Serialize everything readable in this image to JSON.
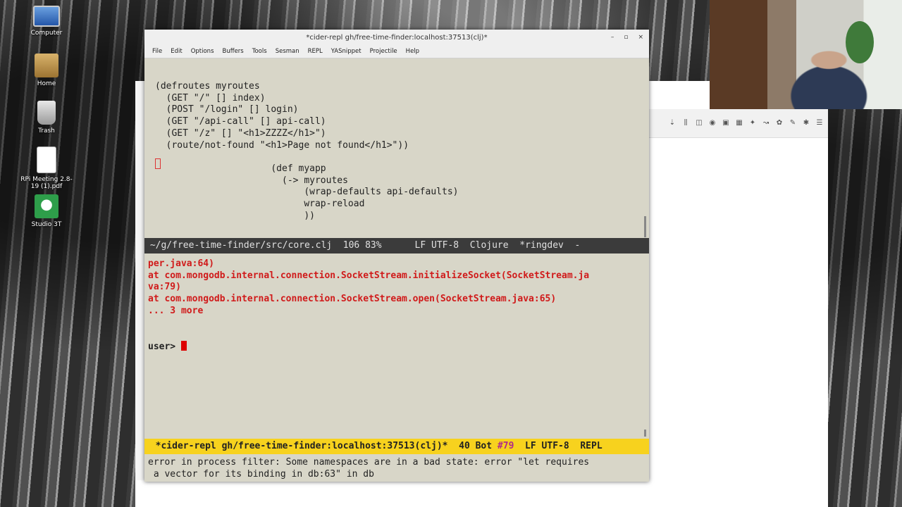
{
  "desktop": {
    "icons": [
      {
        "label": "Computer"
      },
      {
        "label": "Home"
      },
      {
        "label": "Trash"
      },
      {
        "label": "RPi Meeting 2.8-19 (1).pdf"
      },
      {
        "label": "Studio 3T"
      }
    ]
  },
  "window": {
    "title": "*cider-repl gh/free-time-finder:localhost:37513(clj)*",
    "controls": {
      "minimize": "–",
      "maximize": "▫",
      "close": "×"
    }
  },
  "menu": [
    "File",
    "Edit",
    "Options",
    "Buffers",
    "Tools",
    "Sesman",
    "REPL",
    "YASnippet",
    "Projectile",
    "Help"
  ],
  "editor": {
    "line1": "(defroutes myroutes",
    "line2": "  (GET \"/\" [] index)",
    "line3": "  (POST \"/login\" [] login)",
    "line4": "  (GET \"/api-call\" [] api-call)",
    "line5": "  (GET \"/z\" [] \"<h1>ZZZZ</h1>\")",
    "line6": "  (route/not-found \"<h1>Page not found</h1>\"))",
    "line7": "                     (def myapp",
    "line8": "                       (-> myroutes",
    "line9": "                           (wrap-defaults api-defaults)",
    "line10": "                           wrap-reload",
    "line11": "                           ))"
  },
  "modeline_editor": {
    "path": " ~/g/free-time-finder/src/core.clj",
    "position": "  106 83%",
    "encoding": "      LF UTF-8",
    "mode": "  Clojure",
    "extra": "  *ringdev  -"
  },
  "repl": {
    "lines": [
      "per.java:64)",
      "at com.mongodb.internal.connection.SocketStream.initializeSocket(SocketStream.ja",
      "va:79)",
      "at com.mongodb.internal.connection.SocketStream.open(SocketStream.java:65)",
      "... 3 more"
    ],
    "prompt": "user> "
  },
  "modeline_repl": {
    "buffer": "  *cider-repl gh/free-time-finder:localhost:37513(clj)*",
    "position": "  40 Bot ",
    "line_no": "#79",
    "encoding": "  LF UTF-8",
    "mode": "  REPL"
  },
  "echo_area": {
    "line1": "error in process filter: Some namespaces are in a bad state: error \"let requires",
    "line2": " a vector for its binding in db:63\" in db"
  },
  "colors": {
    "emacs_bg": "#d8d6c8",
    "modeline_dark": "#3b3b3b",
    "modeline_repl": "#f7d21e",
    "error_red": "#d01a1a"
  }
}
